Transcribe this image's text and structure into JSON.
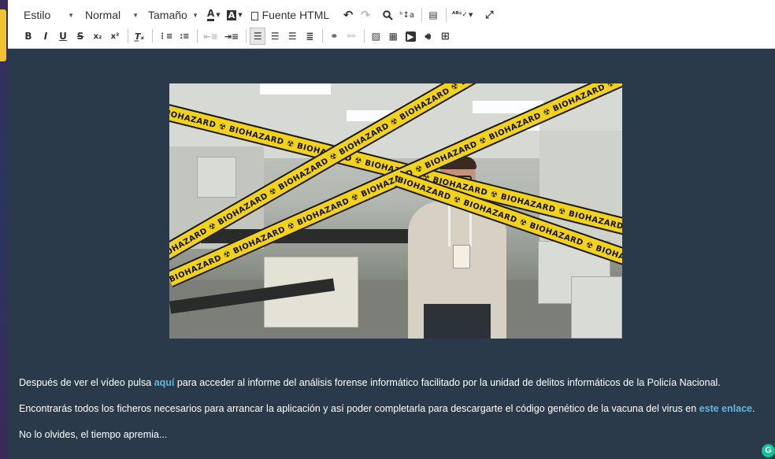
{
  "toolbar": {
    "style_dropdown": "Estilo",
    "format_dropdown": "Normal",
    "size_dropdown": "Tamaño",
    "source_button": "Fuente HTML",
    "row1_icons": [
      "text-color-icon",
      "bg-color-icon",
      "undo-icon",
      "redo-icon",
      "find-icon",
      "replace-icon",
      "paragraph-icon",
      "spellcheck-icon",
      "maximize-icon"
    ],
    "row2_buttons": {
      "bold": "B",
      "italic": "I",
      "underline": "U",
      "strike": "S",
      "subscript": "x₂",
      "superscript": "x²",
      "remove_format": "T̲ₓ"
    },
    "row2_icons": [
      "bold-icon",
      "italic-icon",
      "underline-icon",
      "strike-icon",
      "subscript-icon",
      "superscript-icon",
      "remove-format-icon",
      "numbered-list-icon",
      "bulleted-list-icon",
      "outdent-icon",
      "indent-icon",
      "align-left-icon",
      "align-center-icon",
      "align-right-icon",
      "justify-icon",
      "link-icon",
      "unlink-icon",
      "image-icon",
      "video-icon",
      "youtube-icon",
      "audio-icon",
      "table-icon"
    ],
    "active_align": "align-left"
  },
  "content": {
    "video_tape_text": "BIOHAZARD ☢ BIOHAZARD ☢ BIOHAZARD ☢ BIOHAZARD ☢ BIOHAZARD ☢ BIOHAZARD ☢ BIOHAZARD ☢",
    "p1_before": "Después de ver el vídeo pulsa ",
    "p1_link": "aquí",
    "p1_after": " para acceder al informe del análisis forense informático facilitado por la unidad de delitos informáticos de la Policía Nacional.",
    "p2_before": "Encontrarás todos los ficheros necesarios para arrancar la aplicación y así poder completarla para descargarte el código genético de la vacuna del virus en ",
    "p2_link": "este enlace",
    "p2_after": ".",
    "p3": "No lo olvides, el tiempo apremia..."
  },
  "colors": {
    "content_bg": "#2b3a4a",
    "link": "#5fb7e0",
    "tape": "#f3d21c",
    "grammarly": "#15c39a"
  },
  "grammarly_badge": "G"
}
